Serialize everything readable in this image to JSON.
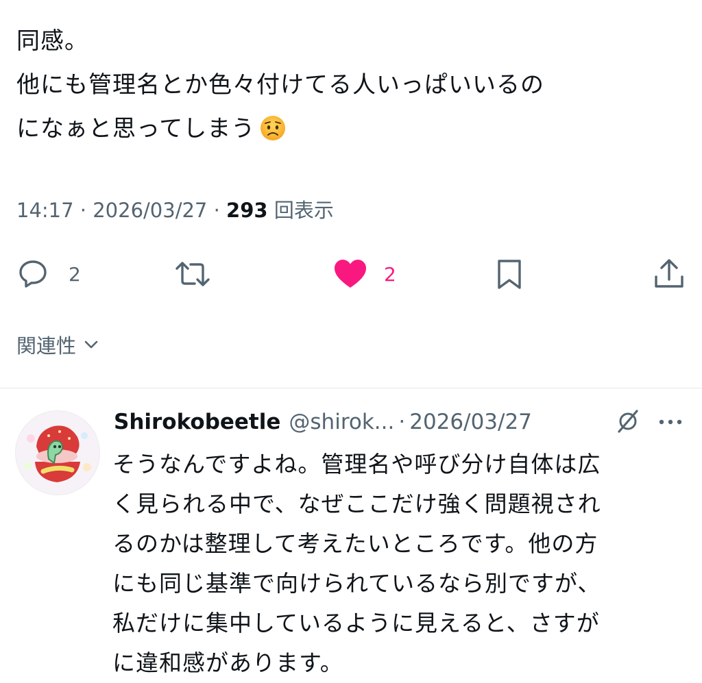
{
  "tweet": {
    "lines": [
      "同感。",
      "他にも管理名とか色々付けてる人いっぱいいるの",
      "になぁと思ってしまう"
    ],
    "emoji": "worried-face-emoji"
  },
  "meta": {
    "time": "14:17",
    "separator": "·",
    "date": "2026/03/27",
    "views_count": "293",
    "views_label": "回表示"
  },
  "actions": {
    "reply_count": "2",
    "like_count": "2"
  },
  "sort": {
    "label": "関連性"
  },
  "reply": {
    "name": "Shirokobeetle",
    "handle": "@shirok...",
    "separator": "·",
    "date": "2026/03/27",
    "lines": [
      "そうなんですよね。管理名や呼び分け自体は広",
      "く見られる中で、なぜここだけ強く問題視され",
      "るのかは整理して考えたいところです。他の方",
      "にも同じ基準で向けられているなら別ですが、",
      "私だけに集中しているように見えると、さすが",
      "に違和感があります。"
    ]
  },
  "colors": {
    "text": "#0f1419",
    "secondary": "#536471",
    "like": "#f91880",
    "divider": "#e4e8eb"
  }
}
